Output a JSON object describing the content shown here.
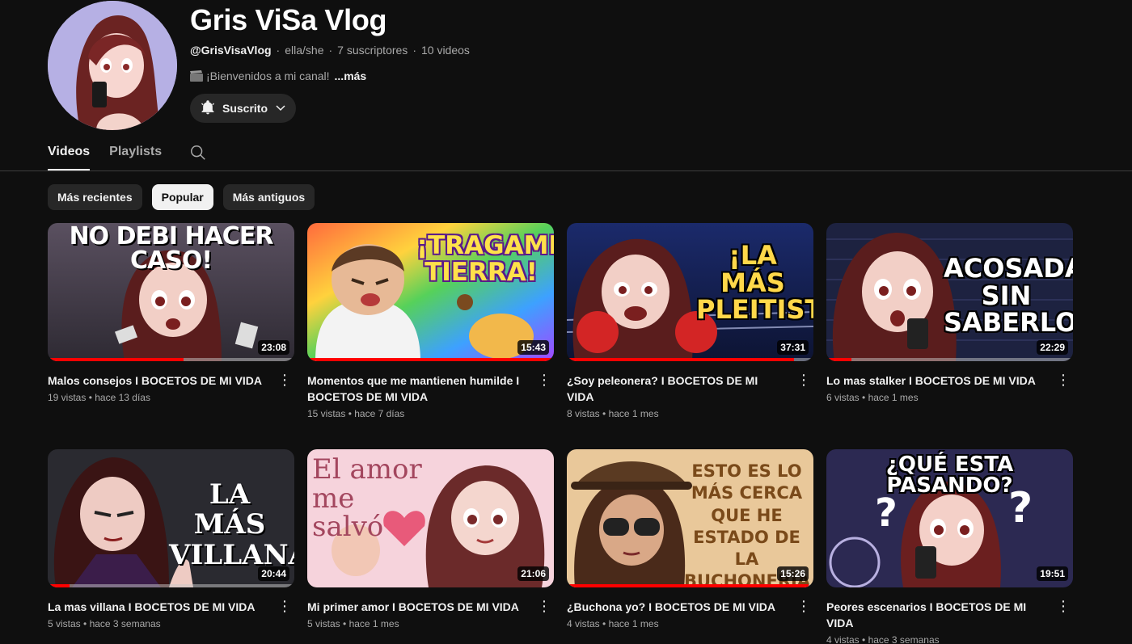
{
  "channel": {
    "name": "Gris ViSa Vlog",
    "handle": "@GrisVisaVlog",
    "pronouns": "ella/she",
    "subscribers": "7 suscriptores",
    "videos": "10 videos",
    "description": "¡Bienvenidos a mi canal!",
    "more": "...más",
    "subscribe_label": "Suscrito"
  },
  "tabs": [
    {
      "label": "Videos",
      "active": true
    },
    {
      "label": "Playlists",
      "active": false
    }
  ],
  "chips": [
    {
      "label": "Más recientes",
      "active": false
    },
    {
      "label": "Popular",
      "active": true
    },
    {
      "label": "Más antiguos",
      "active": false
    }
  ],
  "videos": [
    {
      "title": "Malos consejos I BOCETOS DE MI VIDA",
      "views": "19 vistas",
      "age": "hace 13 días",
      "duration": "23:08",
      "thumb_text": "NO DEBI HACER CASO!",
      "progress": 0.55
    },
    {
      "title": "Momentos que me mantienen humilde I BOCETOS DE MI VIDA",
      "views": "15 vistas",
      "age": "hace 7 días",
      "duration": "15:43",
      "thumb_text": "¡TRAGAME TIERRA!",
      "progress": 1.0
    },
    {
      "title": "¿Soy peleonera? I BOCETOS DE MI VIDA",
      "views": "8 vistas",
      "age": "hace 1 mes",
      "duration": "37:31",
      "thumb_text": "¡LA MÁS PLEITISTA!",
      "progress": 0.92
    },
    {
      "title": "Lo mas stalker I BOCETOS DE MI VIDA",
      "views": "6 vistas",
      "age": "hace 1 mes",
      "duration": "22:29",
      "thumb_text": "ACOSADA SIN SABERLO",
      "progress": 0.1
    },
    {
      "title": "La mas villana I BOCETOS DE MI VIDA",
      "views": "5 vistas",
      "age": "hace 3 semanas",
      "duration": "20:44",
      "thumb_text": "LA MÁS VILLANA",
      "progress": 0.09
    },
    {
      "title": "Mi primer amor I BOCETOS DE MI VIDA",
      "views": "5 vistas",
      "age": "hace 1 mes",
      "duration": "21:06",
      "thumb_text": "El amor me salvó",
      "progress": 0.0
    },
    {
      "title": "¿Buchona yo? I BOCETOS DE MI VIDA",
      "views": "4 vistas",
      "age": "hace 1 mes",
      "duration": "15:26",
      "thumb_text": "ESTO ES LO MÁS CERCA QUE HE ESTADO DE LA BUCHONERÍA",
      "progress": 0.98
    },
    {
      "title": "Peores escenarios I BOCETOS DE MI VIDA",
      "views": "4 vistas",
      "age": "hace 3 semanas",
      "duration": "19:51",
      "thumb_text": "¿QUÉ ESTA PASANDO?",
      "progress": 0.0
    }
  ],
  "colors": {
    "background": "#0f0f0f",
    "accent": "#ff0000",
    "chip": "#272727"
  }
}
